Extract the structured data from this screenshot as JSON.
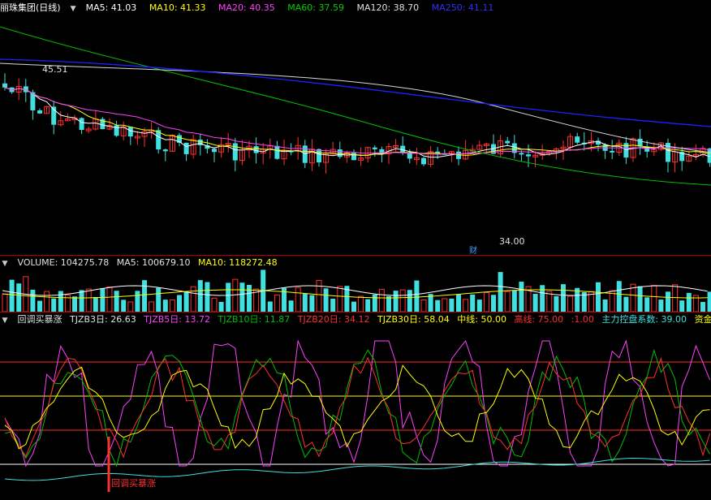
{
  "main": {
    "title": "丽珠集团(日线)",
    "indicators": [
      {
        "label": "MA5: 41.03",
        "color": "#ffffff"
      },
      {
        "label": "MA10: 41.33",
        "color": "#ffff00"
      },
      {
        "label": "MA20: 40.35",
        "color": "#ff40ff"
      },
      {
        "label": "MA60: 37.59",
        "color": "#00d000"
      },
      {
        "label": "MA120: 38.70",
        "color": "#e0e0e0"
      },
      {
        "label": "MA250: 41.11",
        "color": "#2020ff"
      }
    ],
    "high_label": "45.51",
    "low_label": "34.00",
    "event_label": "财"
  },
  "volume": {
    "indicators": [
      {
        "label": "VOLUME: 104275.78",
        "color": "#e0e0e0"
      },
      {
        "label": "MA5: 100679.10",
        "color": "#e0e0e0"
      },
      {
        "label": "MA10: 118272.48",
        "color": "#ffff00"
      }
    ]
  },
  "oscillator": {
    "indicators": [
      {
        "label": "回调买暴涨",
        "color": "#e0e0e0"
      },
      {
        "label": "TJZB3日: 26.63",
        "color": "#e0e0e0"
      },
      {
        "label": "TJZB5日: 13.72",
        "color": "#ff40ff"
      },
      {
        "label": "TJZB10日: 11.87",
        "color": "#00c000"
      },
      {
        "label": "TJZB20日: 34.12",
        "color": "#ff3030"
      },
      {
        "label": "TJZB30日: 58.04",
        "color": "#ffff00"
      },
      {
        "label": "中线: 50.00",
        "color": "#ffff00"
      },
      {
        "label": "高线: 75.00",
        "color": "#ff3030"
      },
      {
        "label": ":1.00",
        "color": "#ff3030"
      },
      {
        "label": "主力控盘系数: 39.00",
        "color": "#40e0e0"
      },
      {
        "label": "资金",
        "color": "#ffff00"
      }
    ],
    "signal_label": "回调买暴涨"
  },
  "colors": {
    "up": "#ff3030",
    "down": "#40e0e0",
    "separator": "#b00000"
  }
}
